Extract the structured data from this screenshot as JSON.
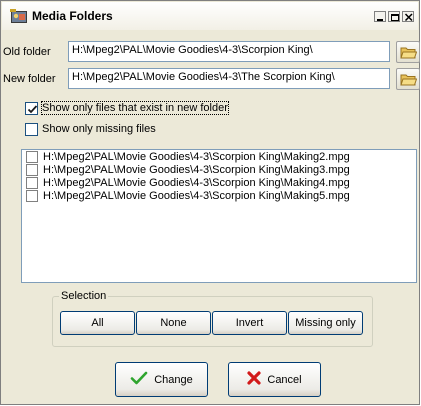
{
  "window": {
    "title": "Media Folders",
    "controls": {
      "minimize": "minimize",
      "maximize": "maximize",
      "close": "close"
    }
  },
  "old_folder": {
    "label": "Old folder",
    "value": "H:\\Mpeg2\\PAL\\Movie Goodies\\4-3\\Scorpion King\\"
  },
  "new_folder": {
    "label": "New folder",
    "value": "H:\\Mpeg2\\PAL\\Movie Goodies\\4-3\\The Scorpion King\\"
  },
  "options": {
    "show_existing": {
      "label": "Show only files that exist in new folder",
      "checked": true
    },
    "show_missing": {
      "label": "Show only missing files",
      "checked": false
    }
  },
  "files": [
    {
      "path": "H:\\Mpeg2\\PAL\\Movie Goodies\\4-3\\Scorpion King\\Making2.mpg",
      "checked": false
    },
    {
      "path": "H:\\Mpeg2\\PAL\\Movie Goodies\\4-3\\Scorpion King\\Making3.mpg",
      "checked": false
    },
    {
      "path": "H:\\Mpeg2\\PAL\\Movie Goodies\\4-3\\Scorpion King\\Making4.mpg",
      "checked": false
    },
    {
      "path": "H:\\Mpeg2\\PAL\\Movie Goodies\\4-3\\Scorpion King\\Making5.mpg",
      "checked": false
    }
  ],
  "selection": {
    "legend": "Selection",
    "all": "All",
    "none": "None",
    "invert": "Invert",
    "missing_only": "Missing only"
  },
  "actions": {
    "change": "Change",
    "cancel": "Cancel"
  },
  "icons": {
    "app": "media-folders-app-icon",
    "browse": "open-folder-icon",
    "change": "checkmark-icon",
    "cancel": "red-x-icon"
  },
  "colors": {
    "dialog_bg": "#ece9d8",
    "field_border": "#7f9db9",
    "check_green": "#2fa52f",
    "cancel_red": "#d21a1a"
  }
}
